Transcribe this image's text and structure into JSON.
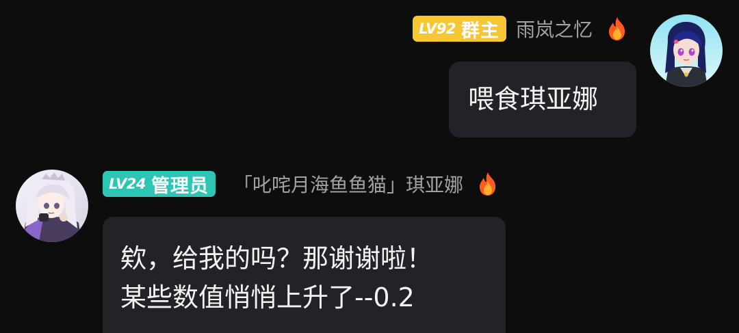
{
  "messages": [
    {
      "sender": "self",
      "level": "LV92",
      "role": "群主",
      "username": "雨岚之忆",
      "lines": [
        "喂食琪亚娜"
      ],
      "avatar_icon": "anime-girl-avatar-blue-hair",
      "badge_color": "#f7c633"
    },
    {
      "sender": "other",
      "level": "LV24",
      "role": "管理员",
      "username": "「叱咤月海鱼鱼猫」琪亚娜",
      "lines": [
        "欸，给我的吗？那谢谢啦！",
        "某些数值悄悄上升了--0.2"
      ],
      "avatar_icon": "anime-girl-avatar-white-hair",
      "badge_color": "#2dc5b4"
    }
  ],
  "icons": {
    "fire": "fire-icon"
  }
}
